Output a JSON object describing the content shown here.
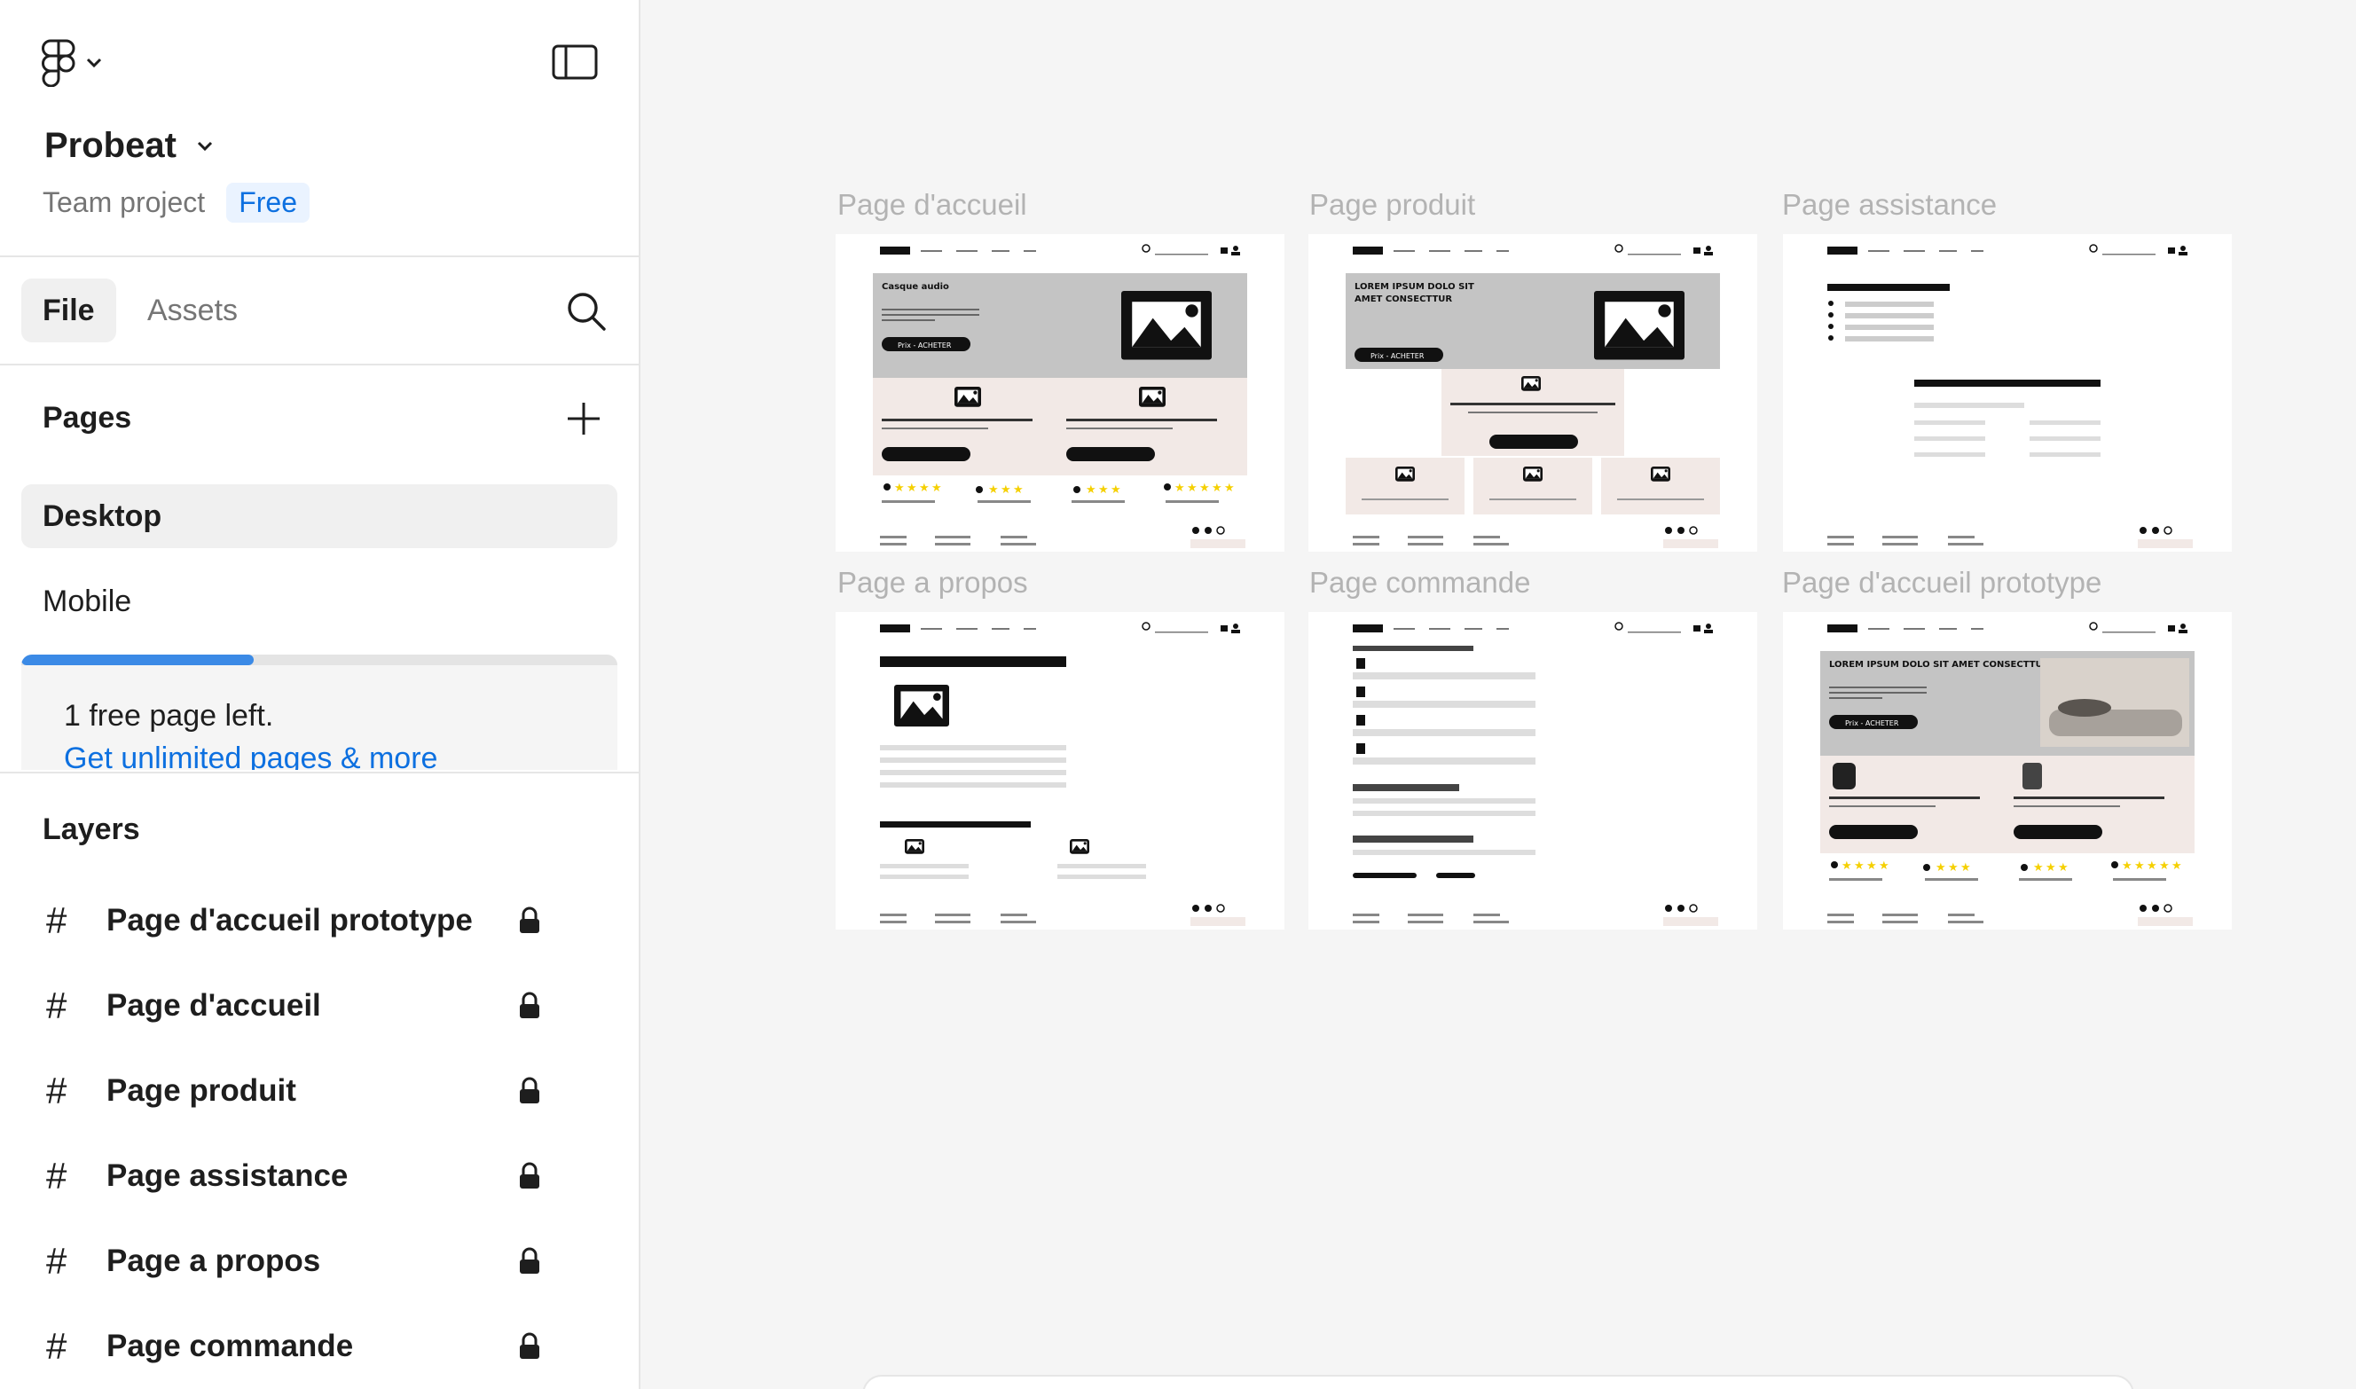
{
  "sidebar": {
    "project_title": "Probeat",
    "project_team": "Team project",
    "project_plan": "Free",
    "tabs": {
      "file": "File",
      "assets": "Assets"
    },
    "pages_heading": "Pages",
    "pages": [
      {
        "label": "Desktop",
        "selected": true
      },
      {
        "label": "Mobile",
        "selected": false
      }
    ],
    "upsell": {
      "progress": 0.39,
      "text": "1 free page left.",
      "link": "Get unlimited pages & more"
    },
    "layers_heading": "Layers",
    "layers": [
      {
        "label": "Page d'accueil prototype",
        "locked": true
      },
      {
        "label": "Page d'accueil",
        "locked": true
      },
      {
        "label": "Page produit",
        "locked": true
      },
      {
        "label": "Page assistance",
        "locked": true
      },
      {
        "label": "Page a propos",
        "locked": true
      },
      {
        "label": "Page commande",
        "locked": true
      }
    ]
  },
  "canvas": {
    "frames": [
      {
        "label": "Page d'accueil",
        "hero_title": "Casque audio",
        "button": "Prix - ACHETER"
      },
      {
        "label": "Page produit",
        "hero_title": "LOREM IPSUM DOLO SIT AMET CONSECTTUR",
        "button": "Prix - ACHETER"
      },
      {
        "label": "Page assistance"
      },
      {
        "label": "Page a propos"
      },
      {
        "label": "Page commande"
      },
      {
        "label": "Page d'accueil prototype",
        "hero_title": "LOREM IPSUM DOLO SIT AMET CONSECTTUR",
        "button": "Prix - ACHETER"
      }
    ]
  },
  "colors": {
    "accent": "#0d70e0",
    "progress": "#3b8ae6",
    "wire_hero": "#c4c4c4",
    "wire_section": "#f2e9e6",
    "star": "#f5d000"
  },
  "icons": [
    "figma-logo-icon",
    "chevron-down-icon",
    "sidebar-toggle-icon",
    "search-icon",
    "plus-icon",
    "frame-hash-icon",
    "lock-icon"
  ]
}
